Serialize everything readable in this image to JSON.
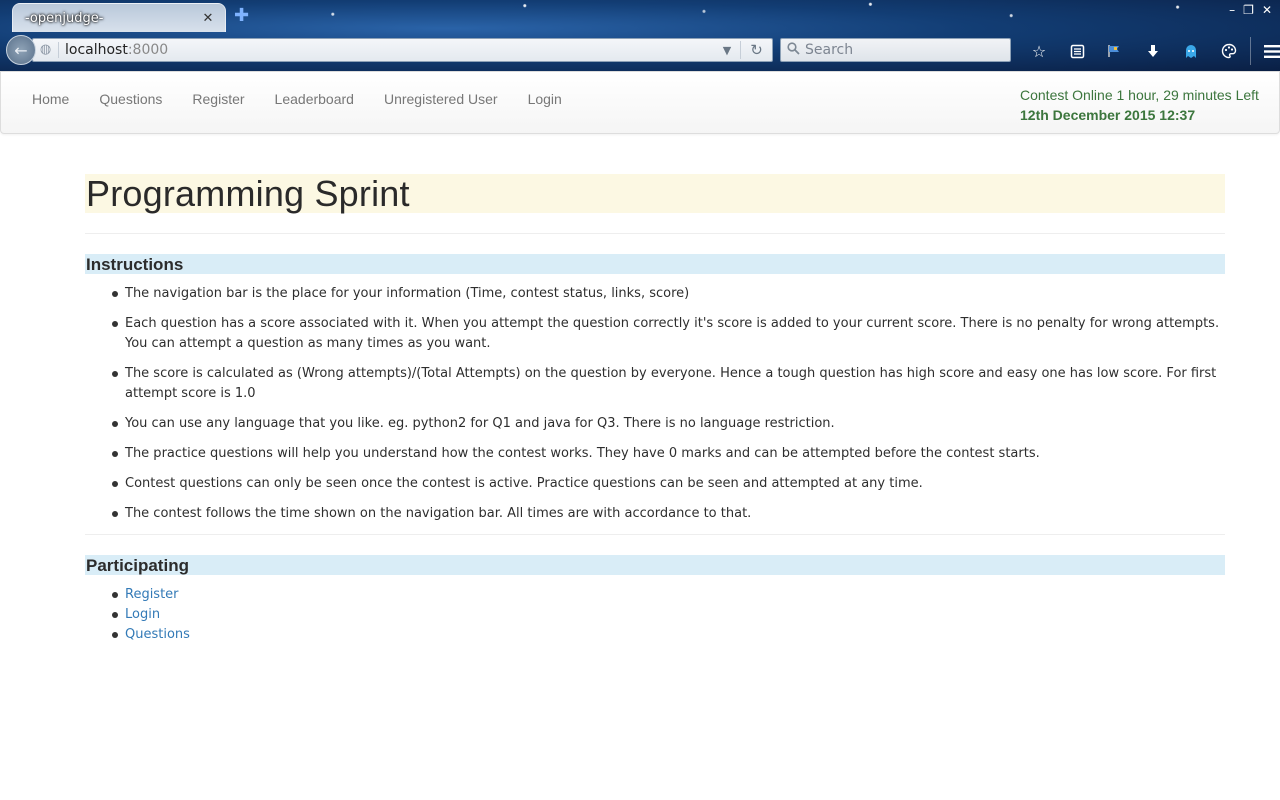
{
  "browser": {
    "tab_title": "-openjudge-",
    "tab_close": "✕",
    "new_tab": "✚",
    "url_host": "localhost",
    "url_port": ":8000",
    "search_placeholder": "Search"
  },
  "navbar": {
    "links": [
      "Home",
      "Questions",
      "Register",
      "Leaderboard",
      "Unregistered User",
      "Login"
    ],
    "contest_status": "Contest Online 1 hour, 29 minutes Left",
    "contest_time": "12th December 2015 12:37",
    "status_color": "#3c763d"
  },
  "page": {
    "title": "Programming Sprint",
    "instructions_heading": "Instructions",
    "instructions": [
      "The navigation bar is the place for your information (Time, contest status, links, score)",
      "Each question has a score associated with it. When you attempt the question correctly it's score is added to your current score. There is no penalty for wrong attempts. You can attempt a question as many times as you want.",
      "The score is calculated as (Wrong attempts)/(Total Attempts) on the question by everyone. Hence a tough question has high score and easy one has low score. For first attempt score is 1.0",
      "You can use any language that you like. eg. python2 for Q1 and java for Q3. There is no language restriction.",
      "The practice questions will help you understand how the contest works. They have 0 marks and can be attempted before the contest starts.",
      "Contest questions can only be seen once the contest is active. Practice questions can be seen and attempted at any time.",
      "The contest follows the time shown on the navigation bar. All times are with accordance to that."
    ],
    "participating_heading": "Participating",
    "participating_links": [
      "Register",
      "Login",
      "Questions"
    ]
  },
  "colors": {
    "title_bg": "#fcf8e3",
    "section_bg": "#d9edf7",
    "link": "#337ab7"
  }
}
